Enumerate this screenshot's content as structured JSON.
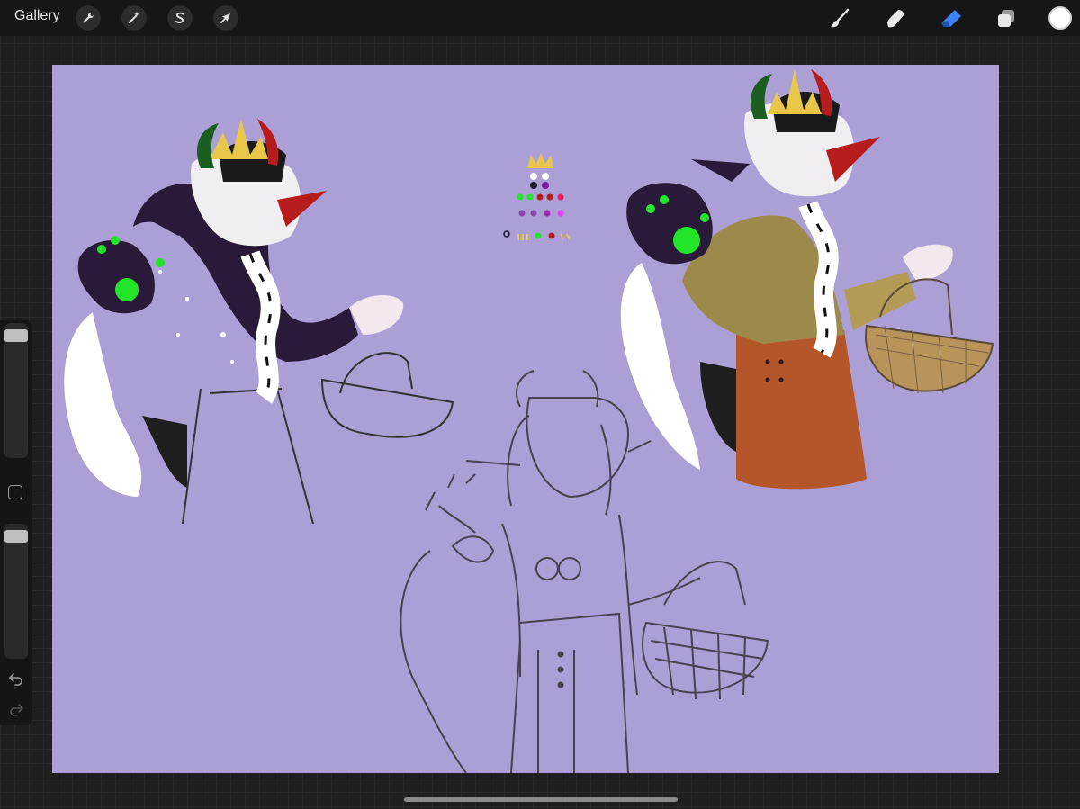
{
  "topbar": {
    "gallery_label": "Gallery",
    "left_tools": [
      {
        "name": "actions",
        "icon": "wrench-icon"
      },
      {
        "name": "adjustments",
        "icon": "magic-wand-icon"
      },
      {
        "name": "selection",
        "icon": "selection-s-icon"
      },
      {
        "name": "transform",
        "icon": "arrow-cursor-icon"
      }
    ],
    "right_tools": [
      {
        "name": "brush",
        "icon": "brush-icon",
        "active": false
      },
      {
        "name": "smudge",
        "icon": "smudge-icon",
        "active": false
      },
      {
        "name": "eraser",
        "icon": "eraser-icon",
        "active": true
      },
      {
        "name": "layers",
        "icon": "layers-icon",
        "active": false
      }
    ],
    "current_color": "#ffffff",
    "active_color": "#3b82f6"
  },
  "sidebar": {
    "brush_size_level": 0.02,
    "opacity_level": 0.02,
    "icons": [
      "modify-button-icon",
      "undo-icon",
      "redo-icon"
    ]
  },
  "canvas": {
    "background": "#ab9fd6"
  }
}
